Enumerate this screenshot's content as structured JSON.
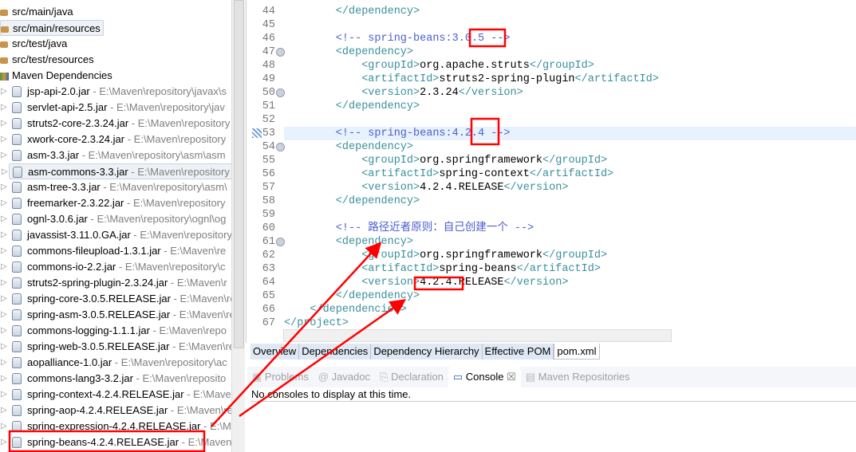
{
  "tree": {
    "folders": [
      "src/main/java",
      "src/main/resources",
      "src/test/java",
      "src/test/resources"
    ],
    "maven_dependencies": "Maven Dependencies",
    "jars": [
      {
        "name": "jsp-api-2.0.jar",
        "path": " - E:\\Maven\\repository\\javax\\s"
      },
      {
        "name": "servlet-api-2.5.jar",
        "path": " - E:\\Maven\\repository\\jav"
      },
      {
        "name": "struts2-core-2.3.24.jar",
        "path": " - E:\\Maven\\repository"
      },
      {
        "name": "xwork-core-2.3.24.jar",
        "path": " - E:\\Maven\\repository"
      },
      {
        "name": "asm-3.3.jar",
        "path": " - E:\\Maven\\repository\\asm\\asm"
      },
      {
        "name": "asm-commons-3.3.jar",
        "path": " - E:\\Maven\\repository"
      },
      {
        "name": "asm-tree-3.3.jar",
        "path": " - E:\\Maven\\repository\\asm\\"
      },
      {
        "name": "freemarker-2.3.22.jar",
        "path": " - E:\\Maven\\repository"
      },
      {
        "name": "ognl-3.0.6.jar",
        "path": " - E:\\Maven\\repository\\ognl\\og"
      },
      {
        "name": "javassist-3.11.0.GA.jar",
        "path": " - E:\\Maven\\repository"
      },
      {
        "name": "commons-fileupload-1.3.1.jar",
        "path": " - E:\\Maven\\re"
      },
      {
        "name": "commons-io-2.2.jar",
        "path": " - E:\\Maven\\repository\\c"
      },
      {
        "name": "struts2-spring-plugin-2.3.24.jar",
        "path": " - E:\\Maven\\r"
      },
      {
        "name": "spring-core-3.0.5.RELEASE.jar",
        "path": " - E:\\Maven\\re"
      },
      {
        "name": "spring-asm-3.0.5.RELEASE.jar",
        "path": " - E:\\Maven\\re"
      },
      {
        "name": "commons-logging-1.1.1.jar",
        "path": " - E:\\Maven\\repo"
      },
      {
        "name": "spring-web-3.0.5.RELEASE.jar",
        "path": " - E:\\Maven\\re"
      },
      {
        "name": "aopalliance-1.0.jar",
        "path": " - E:\\Maven\\repository\\ac"
      },
      {
        "name": "commons-lang3-3.2.jar",
        "path": " - E:\\Maven\\reposito"
      },
      {
        "name": "spring-context-4.2.4.RELEASE.jar",
        "path": " - E:\\Maven"
      },
      {
        "name": "spring-aop-4.2.4.RELEASE.jar",
        "path": " - E:\\Maven\\re"
      },
      {
        "name": "spring-expression-4.2.4.RELEASE.jar",
        "path": " - E:\\Ma"
      },
      {
        "name": "spring-beans-4.2.4.RELEASE.jar",
        "path": " - E:\\Maven\\"
      }
    ]
  },
  "editor": {
    "lines": [
      {
        "n": "44",
        "indent": 2,
        "parts": [
          [
            "t",
            "</dependency>"
          ]
        ]
      },
      {
        "n": "45",
        "indent": 0,
        "parts": []
      },
      {
        "n": "46",
        "indent": 2,
        "parts": [
          [
            "c",
            "<!-- spring-beans:3.0.5 -->"
          ]
        ]
      },
      {
        "n": "47",
        "indent": 2,
        "fold": true,
        "parts": [
          [
            "t",
            "<dependency>"
          ]
        ]
      },
      {
        "n": "48",
        "indent": 3,
        "parts": [
          [
            "t",
            "<groupId>"
          ],
          [
            "v",
            "org.apache.struts"
          ],
          [
            "t",
            "</groupId>"
          ]
        ]
      },
      {
        "n": "49",
        "indent": 3,
        "parts": [
          [
            "t",
            "<artifactId>"
          ],
          [
            "v",
            "struts2-spring-plugin"
          ],
          [
            "t",
            "</artifactId>"
          ]
        ]
      },
      {
        "n": "50",
        "indent": 3,
        "fold": true,
        "parts": [
          [
            "t",
            "<version>"
          ],
          [
            "v",
            "2.3.24"
          ],
          [
            "t",
            "</version>"
          ]
        ]
      },
      {
        "n": "51",
        "indent": 2,
        "parts": [
          [
            "t",
            "</dependency>"
          ]
        ]
      },
      {
        "n": "52",
        "indent": 0,
        "parts": []
      },
      {
        "n": "53",
        "indent": 2,
        "current": true,
        "parts": [
          [
            "c",
            "<!-- spring-beans:4.2.4 -->"
          ]
        ]
      },
      {
        "n": "54",
        "indent": 2,
        "fold": true,
        "parts": [
          [
            "t",
            "<dependency>"
          ]
        ]
      },
      {
        "n": "55",
        "indent": 3,
        "parts": [
          [
            "t",
            "<groupId>"
          ],
          [
            "v",
            "org.springframework"
          ],
          [
            "t",
            "</groupId>"
          ]
        ]
      },
      {
        "n": "56",
        "indent": 3,
        "parts": [
          [
            "t",
            "<artifactId>"
          ],
          [
            "v",
            "spring-context"
          ],
          [
            "t",
            "</artifactId>"
          ]
        ]
      },
      {
        "n": "57",
        "indent": 3,
        "parts": [
          [
            "t",
            "<version>"
          ],
          [
            "v",
            "4.2.4.RELEASE"
          ],
          [
            "t",
            "</version>"
          ]
        ]
      },
      {
        "n": "58",
        "indent": 2,
        "parts": [
          [
            "t",
            "</dependency>"
          ]
        ]
      },
      {
        "n": "59",
        "indent": 0,
        "parts": []
      },
      {
        "n": "60",
        "indent": 2,
        "parts": [
          [
            "c",
            "<!-- 路径近者原则：自己创建一个 -->"
          ]
        ]
      },
      {
        "n": "61",
        "indent": 2,
        "fold": true,
        "parts": [
          [
            "t",
            "<dependency>"
          ]
        ]
      },
      {
        "n": "62",
        "indent": 3,
        "parts": [
          [
            "t",
            "<groupId>"
          ],
          [
            "v",
            "org.springframework"
          ],
          [
            "t",
            "</groupId>"
          ]
        ]
      },
      {
        "n": "63",
        "indent": 3,
        "parts": [
          [
            "t",
            "<artifactId>"
          ],
          [
            "v",
            "spring-beans"
          ],
          [
            "t",
            "</artifactId>"
          ]
        ]
      },
      {
        "n": "64",
        "indent": 3,
        "parts": [
          [
            "t",
            "<version>"
          ],
          [
            "v",
            "4.2.4.RELEASE"
          ],
          [
            "t",
            "</version>"
          ]
        ]
      },
      {
        "n": "65",
        "indent": 2,
        "parts": [
          [
            "t",
            "</dependency>"
          ]
        ]
      },
      {
        "n": "66",
        "indent": 1,
        "parts": [
          [
            "t",
            "</dependencies>"
          ]
        ]
      },
      {
        "n": "67",
        "indent": 0,
        "parts": [
          [
            "t",
            "</project>"
          ]
        ]
      }
    ],
    "tabs": [
      "Overview",
      "Dependencies",
      "Dependency Hierarchy",
      "Effective POM",
      "pom.xml"
    ],
    "active_tab": "pom.xml"
  },
  "console": {
    "tabs": [
      "Problems",
      "Javadoc",
      "Declaration",
      "Console",
      "Maven Repositories"
    ],
    "active_tab": "Console",
    "message": "No consoles to display at this time."
  },
  "annotation_color": "#ff0000"
}
